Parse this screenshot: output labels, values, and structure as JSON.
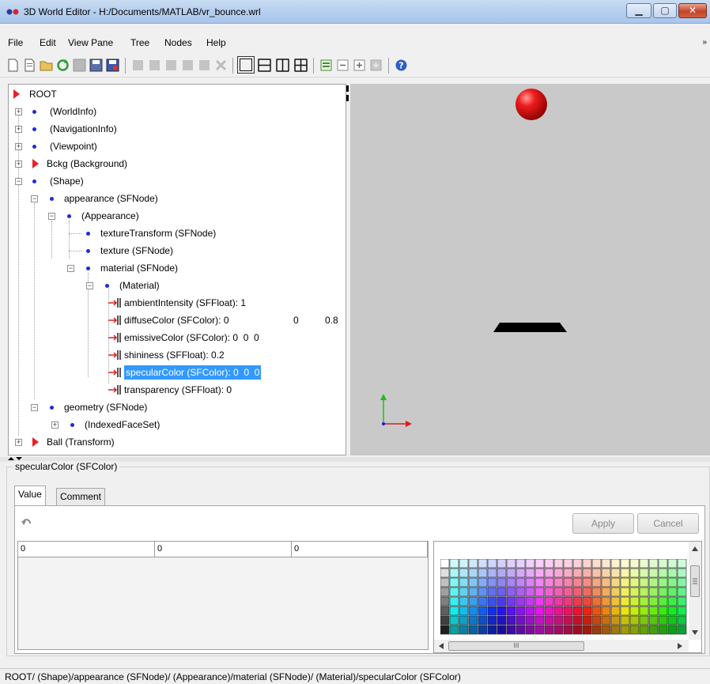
{
  "window": {
    "title": "3D World Editor - H:/Documents/MATLAB/vr_bounce.wrl",
    "minimize_glyph": "▁",
    "maximize_glyph": "▢",
    "close_glyph": "✕"
  },
  "menu": {
    "items": [
      "File",
      "Edit",
      "View Pane",
      "Tree",
      "Nodes",
      "Help"
    ],
    "overflow_glyph": "»"
  },
  "toolbar": {
    "icons": [
      "new-file-icon",
      "new-from-template-icon",
      "open-folder-icon",
      "reload-icon",
      "save-icon",
      "save-as-icon",
      "export-icon",
      "undo-icon",
      "copy-icon",
      "cut-icon",
      "paste-icon",
      "paste-special-icon",
      "delete-icon",
      "single-view-icon",
      "split-horizontal-icon",
      "split-vertical-icon",
      "quad-view-icon",
      "list-icon",
      "collapse-icon",
      "expand-icon",
      "add-icon",
      "help-icon"
    ]
  },
  "tree": {
    "rows": [
      {
        "label": "ROOT",
        "type": "root"
      },
      {
        "label": "(WorldInfo)",
        "type": "node"
      },
      {
        "label": "(NavigationInfo)",
        "type": "node"
      },
      {
        "label": "(Viewpoint)",
        "type": "node"
      },
      {
        "label": "Bckg (Background)",
        "type": "group"
      },
      {
        "label": "(Shape)",
        "type": "node"
      },
      {
        "label": "appearance (SFNode)",
        "type": "node"
      },
      {
        "label": "(Appearance)",
        "type": "node"
      },
      {
        "label": "textureTransform (SFNode)",
        "type": "node"
      },
      {
        "label": "texture (SFNode)",
        "type": "node"
      },
      {
        "label": "material (SFNode)",
        "type": "node"
      },
      {
        "label": "(Material)",
        "type": "node"
      },
      {
        "label": "ambientIntensity (SFFloat): 1",
        "type": "field"
      },
      {
        "label": "diffuseColor (SFColor): 0",
        "type": "field",
        "extra": [
          "0",
          "0.8"
        ]
      },
      {
        "label": "emissiveColor (SFColor): 0  0  0",
        "type": "field"
      },
      {
        "label": "shininess (SFFloat): 0.2",
        "type": "field"
      },
      {
        "label": "specularColor (SFColor): 0  0  0",
        "type": "field"
      },
      {
        "label": "transparency (SFFloat): 0",
        "type": "field"
      },
      {
        "label": "geometry (SFNode)",
        "type": "node"
      },
      {
        "label": "(IndexedFaceSet)",
        "type": "node"
      },
      {
        "label": "Ball (Transform)",
        "type": "group"
      }
    ]
  },
  "properties": {
    "title": "specularColor (SFColor)",
    "tabs": [
      "Value",
      "Comment"
    ],
    "undo_icon": "undo-icon",
    "apply_label": "Apply",
    "cancel_label": "Cancel",
    "values": [
      "0",
      "0",
      "0"
    ]
  },
  "palette": {
    "scrollbar_mark": "III"
  },
  "status": {
    "path": "ROOT/ (Shape)/appearance (SFNode)/ (Appearance)/material (SFNode)/ (Material)/specularColor (SFColor)"
  },
  "colors": {
    "accent": "#3399ff",
    "node_dot": "#1f2bd8",
    "group_triangle": "#e8202a",
    "view_background": "#c9c9c9",
    "ball": "#e01010"
  }
}
